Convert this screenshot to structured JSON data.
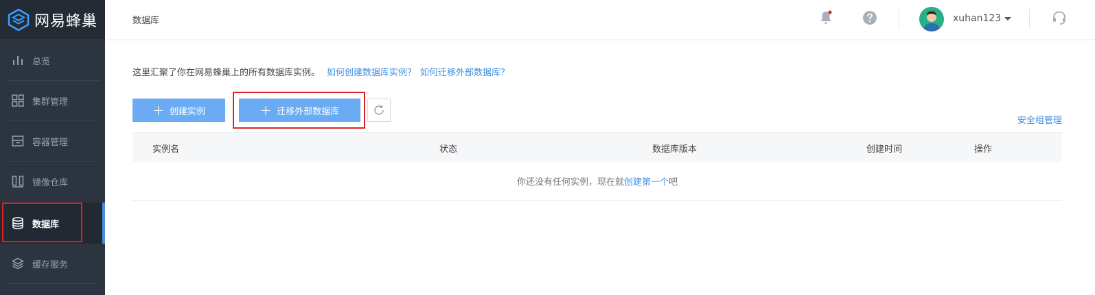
{
  "brand": {
    "name": "网易蜂巢"
  },
  "sidebar": {
    "items": [
      {
        "label": "总览",
        "icon": "bar-chart-icon"
      },
      {
        "label": "集群管理",
        "icon": "grid-icon"
      },
      {
        "label": "容器管理",
        "icon": "container-icon"
      },
      {
        "label": "镜像仓库",
        "icon": "image-repo-icon"
      },
      {
        "label": "数据库",
        "icon": "database-icon",
        "active": true
      },
      {
        "label": "缓存服务",
        "icon": "layers-icon"
      }
    ]
  },
  "header": {
    "breadcrumb": "数据库",
    "username": "xuhan123"
  },
  "main": {
    "intro_text": "这里汇聚了你在网易蜂巢上的所有数据库实例。",
    "help_link_create": "如何创建数据库实例？",
    "help_link_migrate": "如何迁移外部数据库？",
    "create_button": "创建实例",
    "migrate_button": "迁移外部数据库",
    "security_group_link": "安全组管理",
    "table": {
      "columns": [
        "实例名",
        "状态",
        "数据库版本",
        "创建时间",
        "操作"
      ],
      "empty_prefix": "你还没有任何实例，现在就",
      "empty_link": "创建第一个",
      "empty_suffix": "吧"
    }
  },
  "colors": {
    "accent": "#4a90e2",
    "button": "#6aabf4",
    "sidebar": "#2c3440",
    "highlight": "#e02020",
    "link": "#3d8fe0"
  }
}
